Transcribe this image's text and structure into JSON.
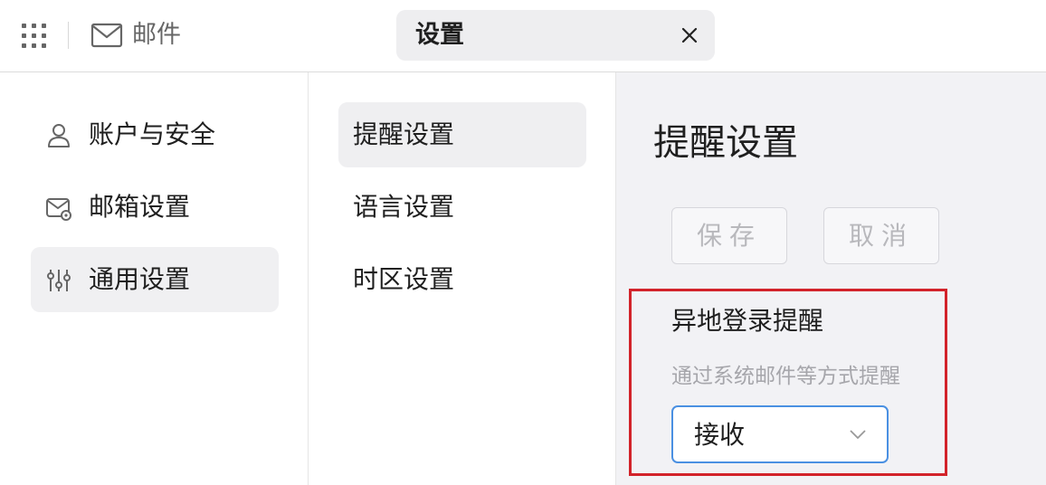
{
  "header": {
    "app_name": "邮件",
    "tab_title": "设置",
    "icons": {
      "apps": "apps-grid-icon",
      "mail": "mail-icon",
      "close": "close-icon"
    }
  },
  "sidebar": {
    "items": [
      {
        "label": "账户与安全",
        "icon": "user-icon"
      },
      {
        "label": "邮箱设置",
        "icon": "mailbox-settings-icon"
      },
      {
        "label": "通用设置",
        "icon": "sliders-icon",
        "active": true
      }
    ]
  },
  "settings_list": {
    "items": [
      {
        "label": "提醒设置",
        "active": true
      },
      {
        "label": "语言设置"
      },
      {
        "label": "时区设置"
      }
    ]
  },
  "panel": {
    "title": "提醒设置",
    "save_label": "保存",
    "cancel_label": "取消",
    "remote_login": {
      "title": "异地登录提醒",
      "description": "通过系统邮件等方式提醒",
      "selected_value": "接收"
    }
  },
  "colors": {
    "highlight": "#d2232a",
    "select_border": "#4a90e2",
    "panel_background": "#f2f2f5"
  }
}
